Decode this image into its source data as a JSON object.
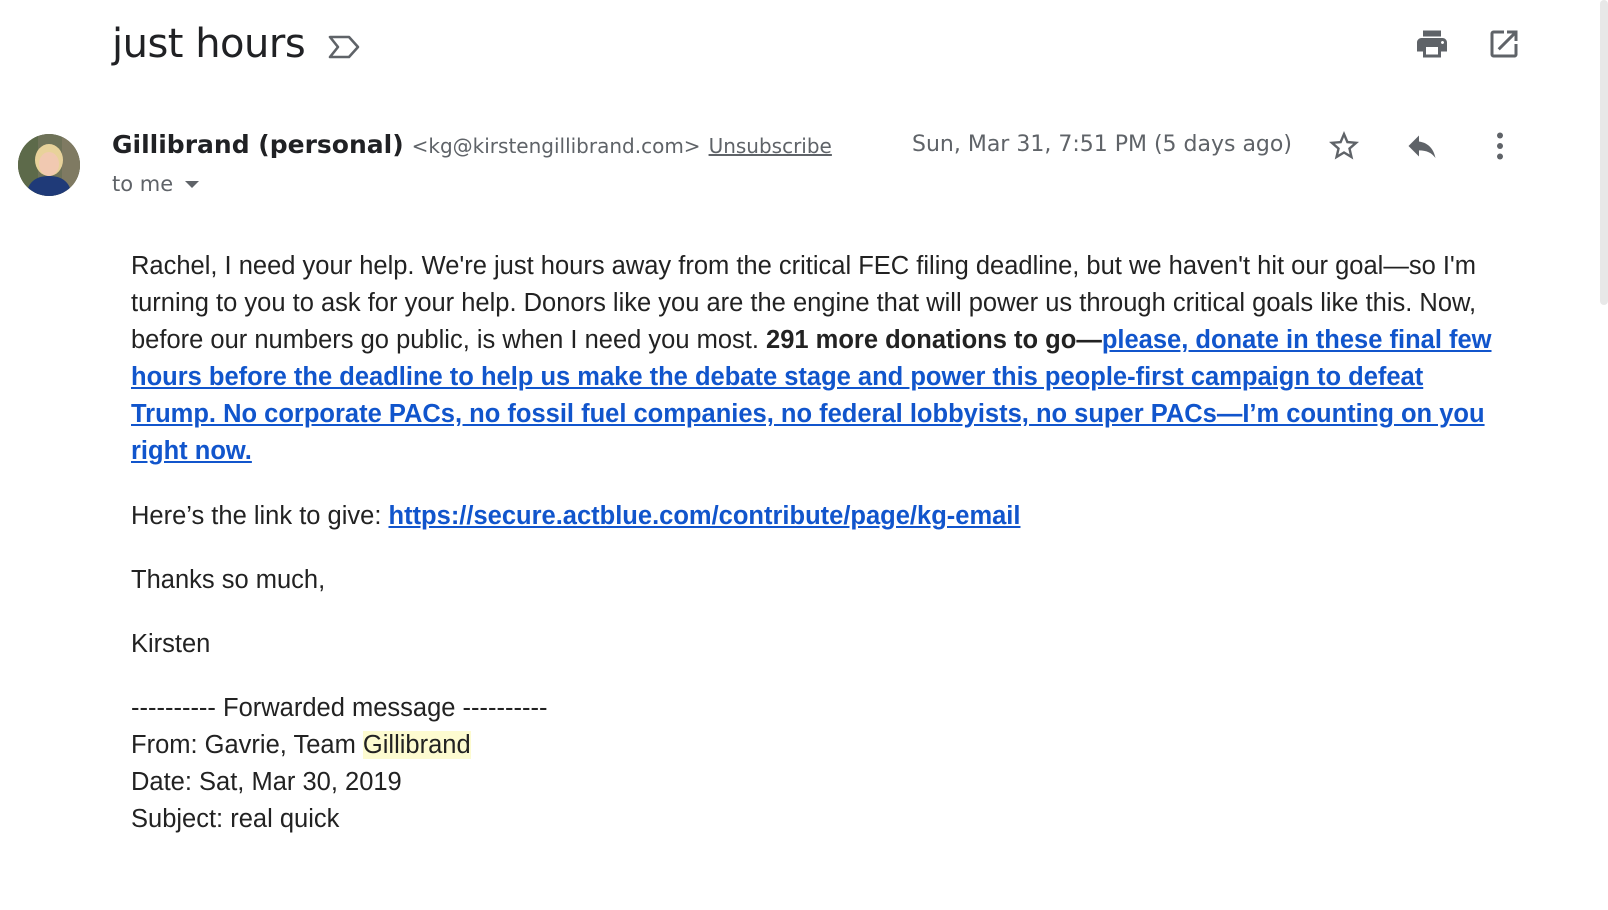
{
  "email": {
    "subject": "just hours",
    "sender": {
      "name": "Gillibrand (personal)",
      "address": "<kg@kirstengillibrand.com>",
      "unsubscribe_label": "Unsubscribe"
    },
    "recipient_label": "to me",
    "date": "Sun, Mar 31, 7:51 PM (5 days ago)",
    "body": {
      "intro_text": "Rachel, I need your help. We're just hours away from the critical FEC filing deadline, but we haven't hit our goal—so I'm turning to you to ask for your help. Donors like you are the engine that will power us through critical goals like this. Now, before our numbers go public, is when I need you most. ",
      "intro_bold": "291 more donations to go—",
      "intro_link": "please, donate in these final few hours before the deadline to help us make the debate stage and power this people-first campaign to defeat Trump. No corporate PACs, no fossil fuel companies, no federal lobbyists, no super PACs—I’m counting on you right now.",
      "link_prefix": "Here’s the link to give: ",
      "link_url": "https://secure.actblue.com/contribute/page/kg-email",
      "thanks": "Thanks so much,",
      "signature": "Kirsten",
      "forwarded": {
        "header": "---------- Forwarded message ----------",
        "from_prefix": "From: Gavrie, Team ",
        "from_highlight": "Gillibrand",
        "date": "Date: Sat, Mar 30, 2019",
        "subject": "Subject: real quick"
      }
    }
  },
  "icons": {
    "important": "important-marker-icon",
    "print": "print-icon",
    "new_window": "open-in-new-window-icon",
    "star": "star-icon",
    "reply": "reply-icon",
    "more": "more-vert-icon",
    "recipient_toggle": "caret-down-icon"
  },
  "colors": {
    "link": "#1155cc",
    "secondary_text": "#5f6368",
    "highlight": "#fdfbd0"
  }
}
